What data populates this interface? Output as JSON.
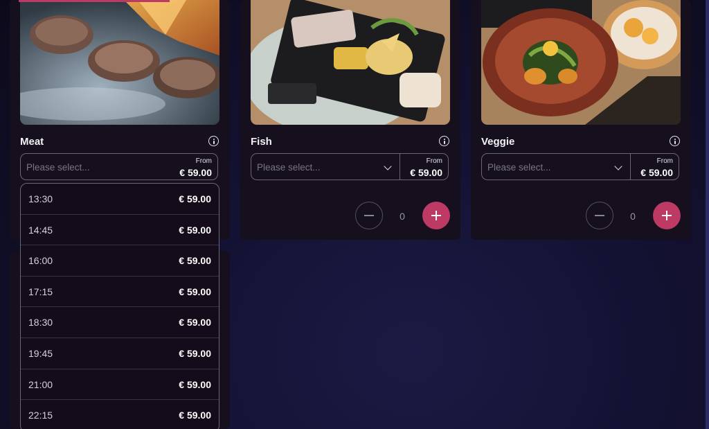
{
  "colors": {
    "accent": "#bd3a64",
    "card_background": "#150f1e",
    "page_background": "#0d0b1d"
  },
  "products": [
    {
      "title": "Meat",
      "info_icon": "info-icon",
      "select_placeholder": "Please select...",
      "price_from_label": "From",
      "price_from": "€ 59.00",
      "dropdown_open": true
    },
    {
      "title": "Fish",
      "info_icon": "info-icon",
      "select_placeholder": "Please select...",
      "price_from_label": "From",
      "price_from": "€ 59.00",
      "quantity": "0",
      "minus_icon": "minus-icon",
      "plus_icon": "plus-icon"
    },
    {
      "title": "Veggie",
      "info_icon": "info-icon",
      "select_placeholder": "Please select...",
      "price_from_label": "From",
      "price_from": "€ 59.00",
      "quantity": "0",
      "minus_icon": "minus-icon",
      "plus_icon": "plus-icon"
    }
  ],
  "meat_dropdown": {
    "options": [
      {
        "time": "13:30",
        "price": "€ 59.00"
      },
      {
        "time": "14:45",
        "price": "€ 59.00"
      },
      {
        "time": "16:00",
        "price": "€ 59.00"
      },
      {
        "time": "17:15",
        "price": "€ 59.00"
      },
      {
        "time": "18:30",
        "price": "€ 59.00"
      },
      {
        "time": "19:45",
        "price": "€ 59.00"
      },
      {
        "time": "21:00",
        "price": "€ 59.00"
      },
      {
        "time": "22:15",
        "price": "€ 59.00"
      }
    ]
  }
}
